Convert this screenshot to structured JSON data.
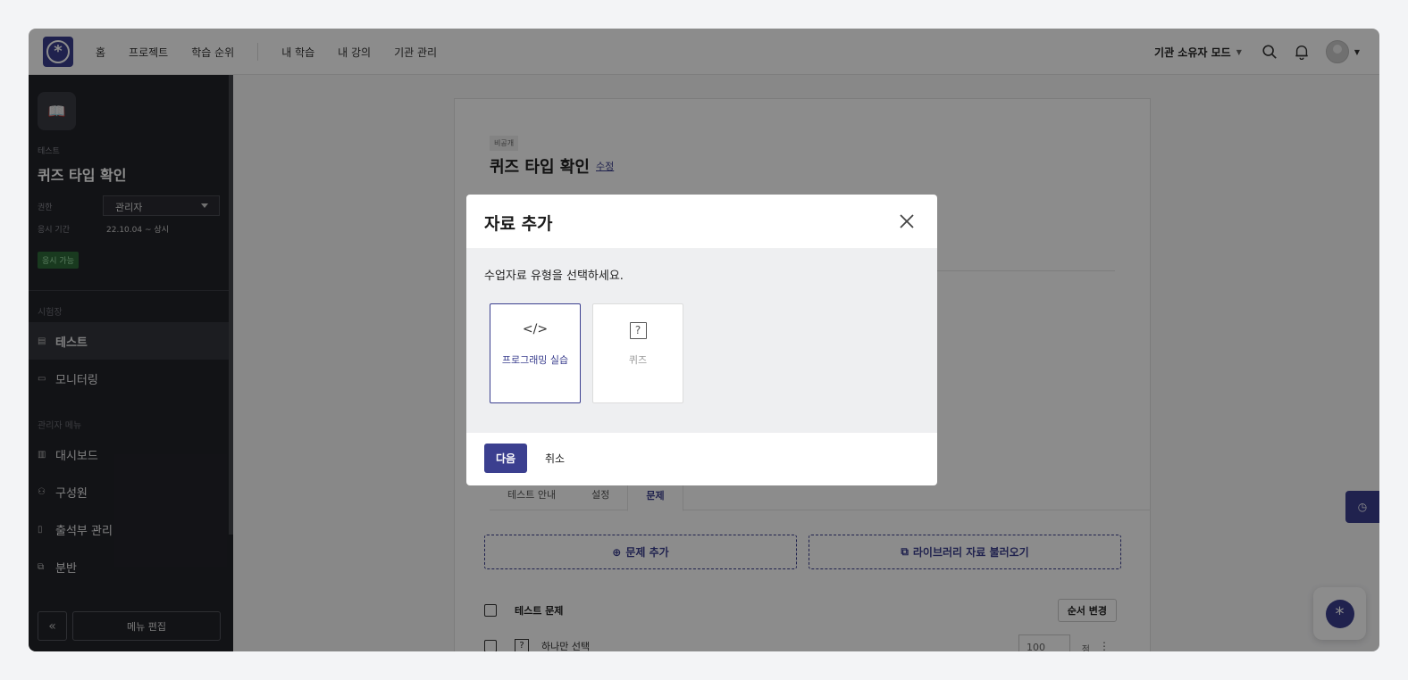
{
  "topnav": {
    "links": [
      "홈",
      "프로젝트",
      "학습 순위"
    ],
    "links2": [
      "내 학습",
      "내 강의",
      "기관 관리"
    ],
    "mode": "기관 소유자 모드"
  },
  "sidebar": {
    "category": "테스트",
    "title": "퀴즈 타입 확인",
    "permission_label": "권한",
    "permission_value": "관리자",
    "period_label": "응시 기간",
    "period_value": "22.10.04 ~ 상시",
    "status_badge": "응시 가능",
    "section1": "시험장",
    "items1": [
      {
        "label": "테스트",
        "icon": "clipboard-icon"
      },
      {
        "label": "모니터링",
        "icon": "monitor-icon"
      }
    ],
    "section2": "관리자 메뉴",
    "items2": [
      {
        "label": "대시보드",
        "icon": "chart-icon"
      },
      {
        "label": "구성원",
        "icon": "users-icon"
      },
      {
        "label": "출석부 관리",
        "icon": "attendance-icon"
      },
      {
        "label": "분반",
        "icon": "copy-icon"
      }
    ],
    "collapse": "«",
    "menu_edit": "메뉴 편집"
  },
  "content": {
    "badge": "비공개",
    "title": "퀴즈 타입 확인",
    "edit": "수정",
    "tabs": [
      "테스트 안내",
      "설정",
      "문제"
    ],
    "add_question": "문제 추가",
    "import_library": "라이브러리 자료 불러오기",
    "list_header": "테스트 문제",
    "order_button": "순서 변경",
    "question_label": "하나만 선택",
    "score_value": "100",
    "score_unit": "점"
  },
  "modal": {
    "title": "자료 추가",
    "instruction": "수업자료 유형을 선택하세요.",
    "types": [
      {
        "label": "프로그래밍 실습",
        "icon": "code-icon",
        "selected": true
      },
      {
        "label": "퀴즈",
        "icon": "question-icon",
        "selected": false
      }
    ],
    "next": "다음",
    "cancel": "취소"
  },
  "colors": {
    "accent": "#3b3f8f",
    "sidebar": "#222329"
  }
}
